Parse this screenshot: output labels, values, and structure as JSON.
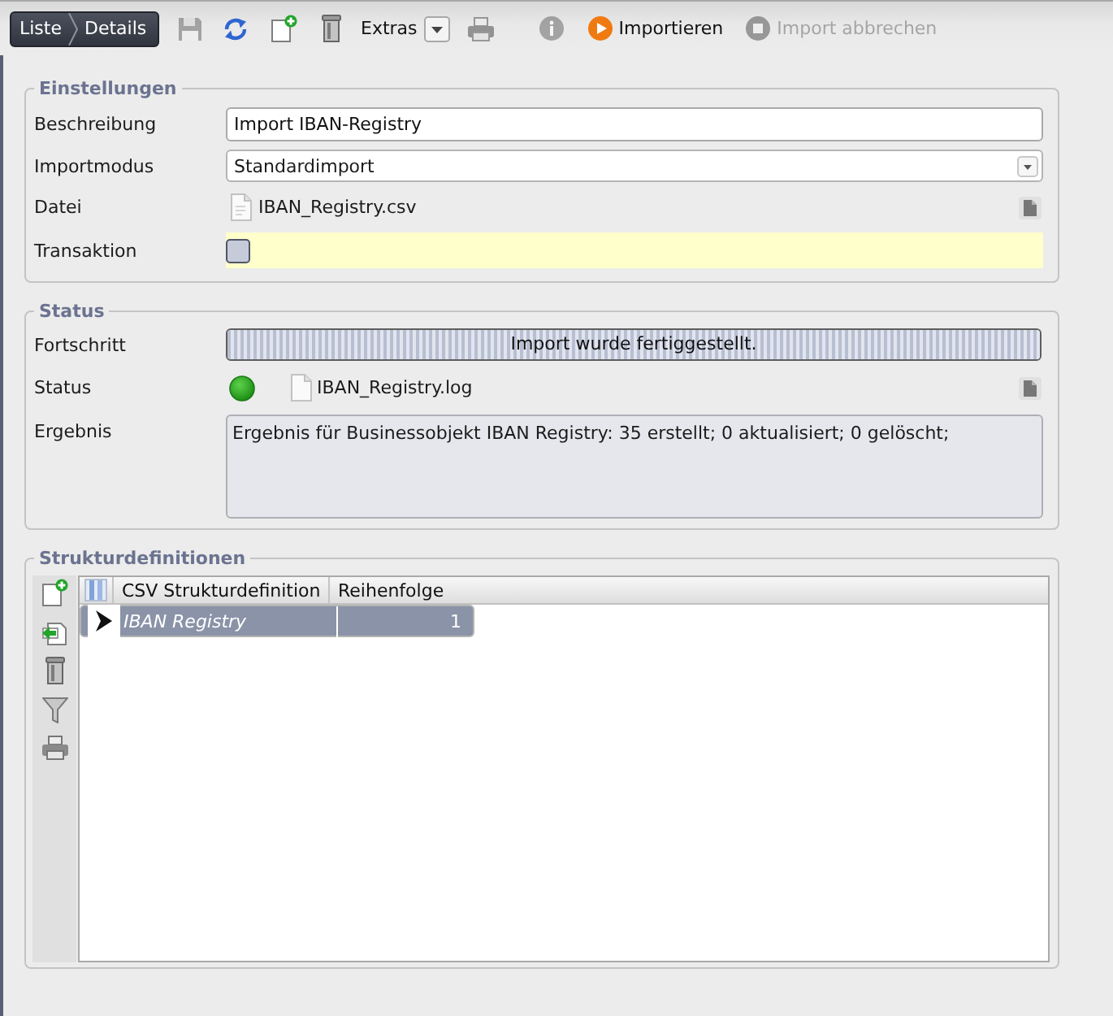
{
  "toolbar": {
    "breadcrumbs": [
      "Liste",
      "Details"
    ],
    "save": {
      "disabled": true
    },
    "refresh": {
      "disabled": false
    },
    "new": {
      "disabled": false
    },
    "delete": {
      "disabled": false
    },
    "extras": {
      "label": "Extras"
    },
    "print": {
      "disabled": true
    },
    "info": {
      "disabled": true
    },
    "import": {
      "label": "Importieren",
      "disabled": false
    },
    "cancel_import": {
      "label": "Import abbrechen",
      "disabled": true
    }
  },
  "settings": {
    "title": "Einstellungen",
    "description": {
      "label": "Beschreibung",
      "value": "Import IBAN-Registry"
    },
    "import_mode": {
      "label": "Importmodus",
      "value": "Standardimport"
    },
    "file": {
      "label": "Datei",
      "value": "IBAN_Registry.csv"
    },
    "transaction": {
      "label": "Transaktion",
      "checked": false,
      "highlighted": true
    }
  },
  "status": {
    "title": "Status",
    "progress": {
      "label": "Fortschritt",
      "level": 1,
      "text": "Import wurde fertiggestellt."
    },
    "state": {
      "label": "Status",
      "ok": true,
      "log_file": "IBAN_Registry.log"
    },
    "result": {
      "label": "Ergebnis",
      "value": "Ergebnis für Businessobjekt IBAN Registry: 35 erstellt; 0 aktualisiert; 0 gelöscht;"
    }
  },
  "structure_definitions": {
    "title": "Strukturdefinitionen",
    "table": {
      "columns": [
        "CSV Strukturdefinition",
        "Reihenfolge"
      ],
      "rows": [
        {
          "cells": [
            "IBAN Registry",
            "1"
          ],
          "selected": true
        }
      ]
    }
  }
}
